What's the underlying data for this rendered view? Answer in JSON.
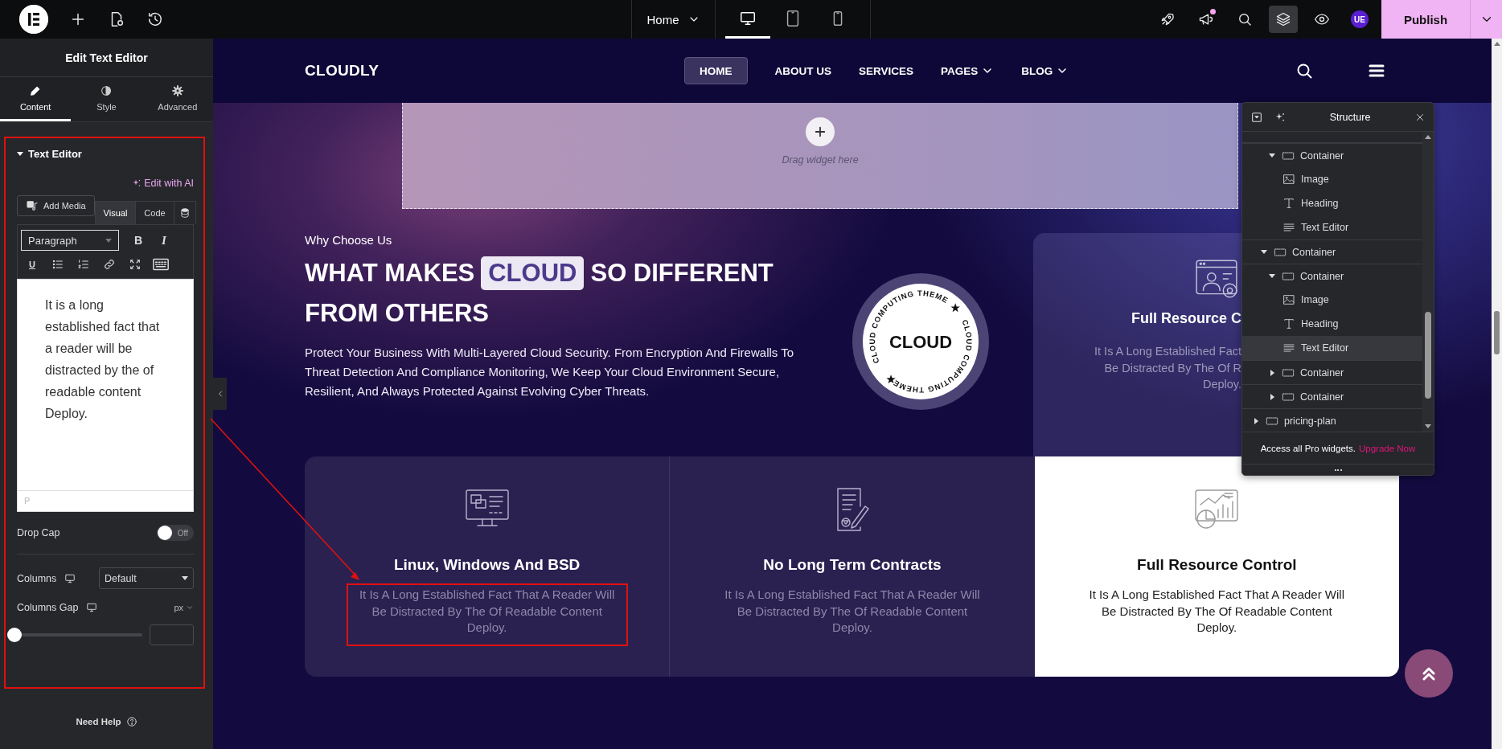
{
  "topbar": {
    "page": "Home",
    "devices": [
      {
        "kind": "desktop",
        "selected": true
      },
      {
        "kind": "tablet",
        "selected": false
      },
      {
        "kind": "mobile",
        "selected": false
      }
    ],
    "tools": [
      {
        "kind": "rocket",
        "selected": false,
        "notification": false
      },
      {
        "kind": "megaphone",
        "selected": false,
        "notification": true
      },
      {
        "kind": "search",
        "selected": false,
        "notification": false
      },
      {
        "kind": "layers",
        "selected": true,
        "notification": false
      },
      {
        "kind": "eye",
        "selected": false,
        "notification": false
      }
    ],
    "avatar": "UE",
    "publish": "Publish"
  },
  "panel": {
    "title": "Edit Text Editor",
    "tabs": [
      {
        "label": "Content",
        "kind": "pencil",
        "selected": true
      },
      {
        "label": "Style",
        "kind": "contrast",
        "selected": false
      },
      {
        "label": "Advanced",
        "kind": "gear",
        "selected": false
      }
    ],
    "section": {
      "title": "Text Editor",
      "expanded": true,
      "annotated": true
    },
    "ai_link": "Edit with AI",
    "add_media": "Add Media",
    "editor_tabs": [
      {
        "label": "Visual",
        "selected": true
      },
      {
        "label": "Code",
        "selected": false
      }
    ],
    "format": "Paragraph",
    "toolbar": [
      {
        "kind": "bold",
        "label": "B"
      },
      {
        "kind": "italic",
        "label": "I"
      },
      {
        "kind": "underline",
        "label": "U"
      },
      {
        "kind": "bullets"
      },
      {
        "kind": "numbers"
      },
      {
        "kind": "link"
      },
      {
        "kind": "fullscreen"
      },
      {
        "kind": "keyboard"
      }
    ],
    "content": "It is a long established fact that a reader will be distracted by the of readable content Deploy.",
    "path": "P",
    "drop_cap": {
      "label": "Drop Cap",
      "on": false,
      "state": "Off"
    },
    "columns": {
      "label": "Columns",
      "value": "Default"
    },
    "columns_gap": {
      "label": "Columns Gap",
      "unit": "px",
      "level": 0
    },
    "help": "Need Help"
  },
  "site": {
    "logo": "CLOUDLY",
    "nav": [
      {
        "label": "HOME",
        "selected": true,
        "dropdown": false
      },
      {
        "label": "ABOUT US",
        "selected": false,
        "dropdown": false
      },
      {
        "label": "SERVICES",
        "selected": false,
        "dropdown": false
      },
      {
        "label": "PAGES",
        "selected": false,
        "dropdown": true
      },
      {
        "label": "BLOG",
        "selected": false,
        "dropdown": true
      }
    ],
    "drop_zone": "Drag widget here",
    "eyebrow": "Why Choose Us",
    "heading_lines": [
      [
        {
          "text": "WHAT MAKES",
          "highlight": false
        },
        {
          "text": "CLOUD",
          "highlight": true
        },
        {
          "text": "SO DIFFERENT",
          "highlight": false
        }
      ],
      [
        {
          "text": "FROM OTHERS",
          "highlight": false
        }
      ]
    ],
    "paragraph": "Protect Your Business With Multi-Layered Cloud Security. From Encryption And Firewalls To Threat Detection And Compliance Monitoring, We Keep Your Cloud Environment Secure, Resilient, And Always Protected Against Evolving Cyber Threats.",
    "badge": {
      "center": "CLOUD",
      "ring_texts": [
        "CLOUD COMPUTING THEME",
        "CLOUD COMPUTING THEME"
      ]
    },
    "top_card": {
      "title": "Full Resource C",
      "lines": [
        "It Is A Long Established Fact",
        "Be Distracted By The Of R",
        "Deploy."
      ]
    },
    "cards": [
      {
        "kind": "monitor",
        "title": "Linux, Windows And BSD",
        "text": "It Is A Long Established Fact That A Reader Will Be Distracted By The Of Readable Content Deploy.",
        "highlighted": false,
        "annotated": true
      },
      {
        "kind": "contract",
        "title": "No Long Term Contracts",
        "text": "It Is A Long Established Fact That A Reader Will Be Distracted By The Of Readable Content Deploy.",
        "highlighted": false,
        "annotated": false
      },
      {
        "kind": "chart",
        "title": "Full Resource Control",
        "text": "It Is A Long Established Fact That A Reader Will Be Distracted By The Of Readable Content Deploy.",
        "highlighted": true,
        "annotated": false
      }
    ]
  },
  "structure": {
    "title": "Structure",
    "tree": [
      {
        "children": [
          {
            "children": [
              {
                "label": "Container",
                "kind": "container",
                "expanded": true,
                "selected": false,
                "children": [
                  {
                    "label": "Image",
                    "kind": "image",
                    "selected": false
                  },
                  {
                    "label": "Heading",
                    "kind": "heading",
                    "selected": false
                  },
                  {
                    "label": "Text Editor",
                    "kind": "text",
                    "selected": false
                  }
                ]
              }
            ]
          }
        ]
      },
      {
        "children": [
          {
            "label": "Container",
            "kind": "container",
            "expanded": true,
            "selected": false,
            "children": [
              {
                "label": "Container",
                "kind": "container",
                "expanded": true,
                "selected": false,
                "children": [
                  {
                    "label": "Image",
                    "kind": "image",
                    "selected": false
                  },
                  {
                    "label": "Heading",
                    "kind": "heading",
                    "selected": false
                  },
                  {
                    "label": "Text Editor",
                    "kind": "text",
                    "selected": true
                  }
                ]
              },
              {
                "label": "Container",
                "kind": "container",
                "expanded": false,
                "selected": false
              },
              {
                "label": "Container",
                "kind": "container",
                "expanded": false,
                "selected": false
              }
            ]
          }
        ]
      },
      {
        "label": "pricing-plan",
        "kind": "container",
        "expanded": false,
        "selected": false
      }
    ],
    "footer": {
      "text": "Access all Pro widgets.",
      "link": "Upgrade Now"
    }
  }
}
